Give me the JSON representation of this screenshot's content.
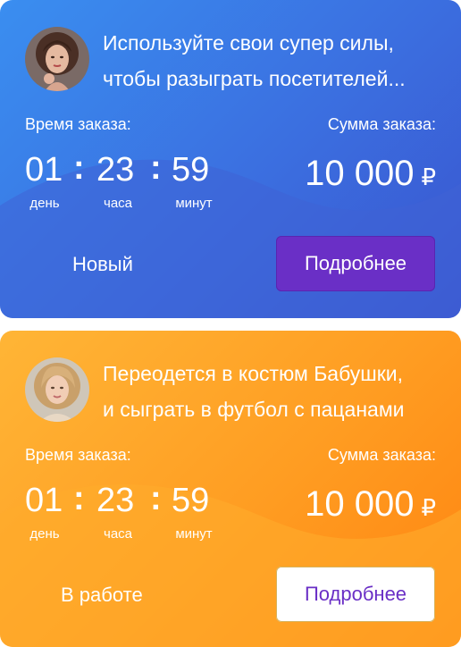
{
  "cards": [
    {
      "title_line1": "Используйте свои супер силы,",
      "title_line2": "чтобы разыграть посетителей...",
      "time_label": "Время заказа:",
      "sum_label": "Сумма заказа:",
      "time": {
        "days": "01",
        "hours": "23",
        "minutes": "59",
        "sep": ":",
        "days_label": "день",
        "hours_label": "часа",
        "minutes_label": "минут"
      },
      "amount": "10 000",
      "currency": "₽",
      "status": "Новый",
      "button_label": "Подробнее",
      "accent_color": "#3b6fe0"
    },
    {
      "title_line1": "Переодется в костюм Бабушки,",
      "title_line2": "и сыграть в футбол с пацанами",
      "time_label": "Время заказа:",
      "sum_label": "Сумма заказа:",
      "time": {
        "days": "01",
        "hours": "23",
        "minutes": "59",
        "sep": ":",
        "days_label": "день",
        "hours_label": "часа",
        "minutes_label": "минут"
      },
      "amount": "10 000",
      "currency": "₽",
      "status": "В работе",
      "button_label": "Подробнее",
      "accent_color": "#ff9d22"
    }
  ]
}
